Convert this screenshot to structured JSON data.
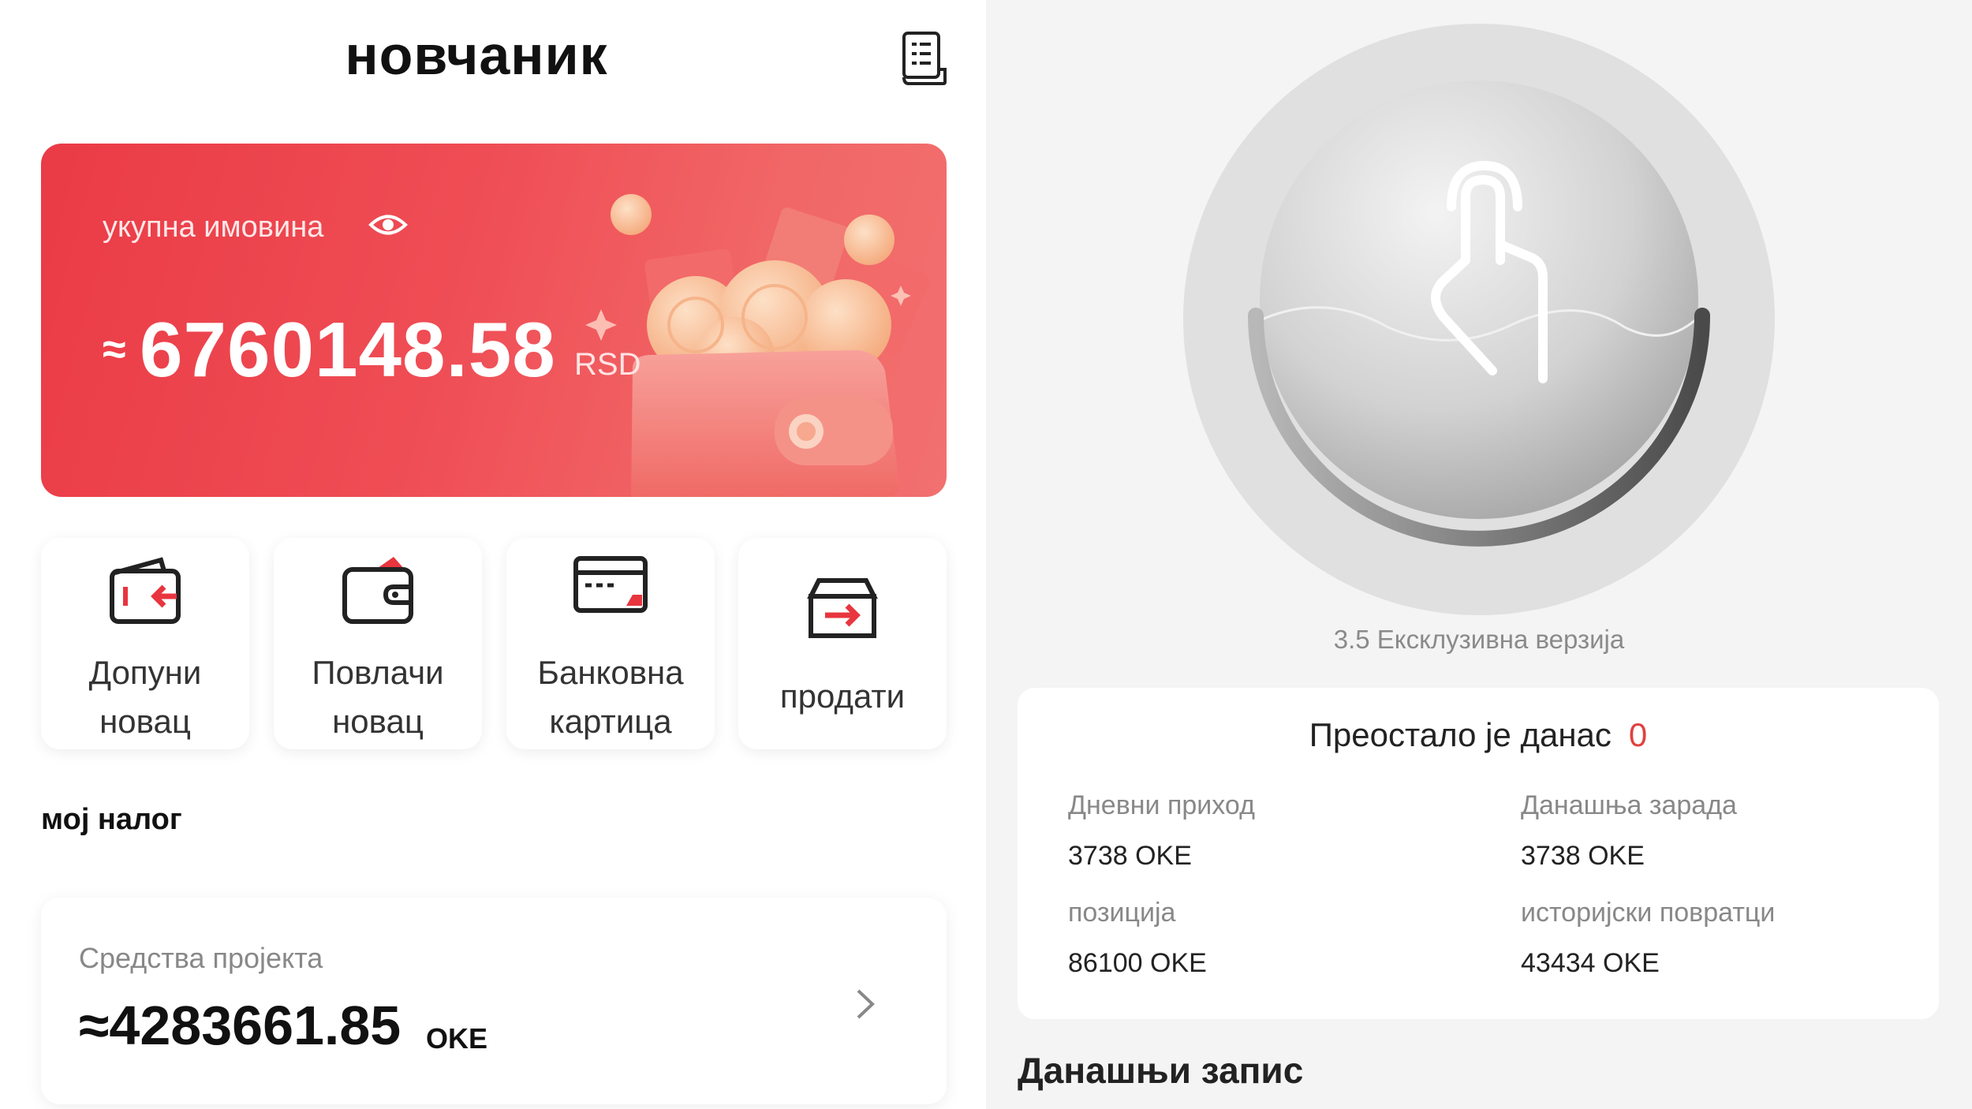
{
  "wallet": {
    "title": "новчаник",
    "asset_label": "укупна имовина",
    "approx": "≈",
    "amount": "6760148.58",
    "currency": "RSD",
    "actions": [
      {
        "line1": "Допуни",
        "line2": "новац"
      },
      {
        "line1": "Повлачи",
        "line2": "новац"
      },
      {
        "line1": "Банковна",
        "line2": "картица"
      },
      {
        "line1": "продати",
        "line2": ""
      }
    ],
    "my_account": "мој налог",
    "project_label": "Средства пројекта",
    "project_amount": "≈4283661.85",
    "project_currency": "OKE"
  },
  "right": {
    "version": "3.5 Ексклузивна верзија",
    "remaining_label": "Преостало је данас",
    "remaining_count": "0",
    "stats": [
      {
        "label": "Дневни приход",
        "value": "3738 OKE"
      },
      {
        "label": "Данашња зарада",
        "value": "3738 OKE"
      },
      {
        "label": "позиција",
        "value": "86100 OKE"
      },
      {
        "label": "историјски повратци",
        "value": "43434 OKE"
      }
    ],
    "today_record": "Данашњи запис"
  },
  "colors": {
    "card_red": "#ea3b46",
    "accent_red": "#e0413f",
    "icon_red": "#e8353e"
  },
  "icons": [
    "record-list-icon",
    "eye-icon",
    "wallet-in-icon",
    "wallet-out-icon",
    "bank-card-icon",
    "box-sell-icon",
    "chevron-right-icon",
    "tap-hand-icon"
  ]
}
